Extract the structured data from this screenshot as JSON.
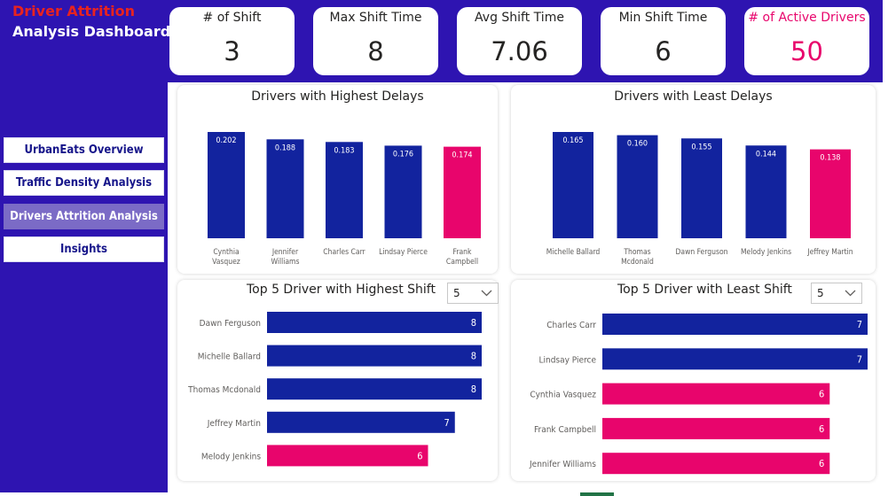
{
  "header": {
    "title_line1": "Driver Attrition",
    "title_line2": "Analysis Dashboard"
  },
  "nav": [
    {
      "label": "UrbanEats Overview",
      "active": false
    },
    {
      "label": "Traffic Density Analysis",
      "active": false
    },
    {
      "label": "Drivers Attrition Analysis",
      "active": true
    },
    {
      "label": "Insights",
      "active": false
    }
  ],
  "kpis": [
    {
      "label": "# of Shift",
      "value": "3",
      "accent": false
    },
    {
      "label": "Max Shift Time",
      "value": "8",
      "accent": false
    },
    {
      "label": "Avg Shift Time",
      "value": "7.06",
      "accent": false
    },
    {
      "label": "Min Shift Time",
      "value": "6",
      "accent": false
    },
    {
      "label": "# of Active Drivers",
      "value": "50",
      "accent": true
    }
  ],
  "colors": {
    "brand": "#2e14b1",
    "bar_primary": "#12239e",
    "bar_highlight": "#e8056c",
    "alert_title": "#e8231f",
    "nav_active": "#7b6bc6"
  },
  "panels": {
    "highest_delays": {
      "title": "Drivers with Highest Delays"
    },
    "least_delays": {
      "title": "Drivers with Least Delays"
    },
    "highest_shift": {
      "title": "Top 5 Driver with Highest Shift",
      "filter_value": "5"
    },
    "least_shift": {
      "title": "Top 5 Driver with Least Shift",
      "filter_value": "5"
    }
  },
  "chart_data": [
    {
      "type": "bar",
      "title": "Drivers with Highest Delays",
      "categories": [
        "Cynthia Vasquez",
        "Jennifer Williams",
        "Charles Carr",
        "Lindsay Pierce",
        "Frank Campbell"
      ],
      "category_lines": [
        [
          "Cynthia",
          "Vasquez"
        ],
        [
          "Jennifer",
          "Williams"
        ],
        [
          "Charles Carr"
        ],
        [
          "Lindsay Pierce"
        ],
        [
          "Frank",
          "Campbell"
        ]
      ],
      "values": [
        0.202,
        0.188,
        0.183,
        0.176,
        0.174
      ],
      "labels": [
        "0.202",
        "0.188",
        "0.183",
        "0.176",
        "0.174"
      ],
      "highlight": [
        false,
        false,
        false,
        false,
        true
      ],
      "ylim": [
        0,
        0.202
      ]
    },
    {
      "type": "bar",
      "title": "Drivers with Least Delays",
      "categories": [
        "Michelle Ballard",
        "Thomas Mcdonald",
        "Dawn Ferguson",
        "Melody Jenkins",
        "Jeffrey Martin"
      ],
      "category_lines": [
        [
          "Michelle Ballard"
        ],
        [
          "Thomas",
          "Mcdonald"
        ],
        [
          "Dawn Ferguson"
        ],
        [
          "Melody Jenkins"
        ],
        [
          "Jeffrey Martin"
        ]
      ],
      "values": [
        0.165,
        0.16,
        0.155,
        0.144,
        0.138
      ],
      "labels": [
        "0.165",
        "0.160",
        "0.155",
        "0.144",
        "0.138"
      ],
      "highlight": [
        false,
        false,
        false,
        false,
        true
      ],
      "ylim": [
        0,
        0.165
      ]
    },
    {
      "type": "bar",
      "orientation": "horizontal",
      "title": "Top 5 Driver with Highest Shift",
      "categories": [
        "Dawn Ferguson",
        "Michelle Ballard",
        "Thomas Mcdonald",
        "Jeffrey Martin",
        "Melody Jenkins"
      ],
      "values": [
        8,
        8,
        8,
        7,
        6
      ],
      "labels": [
        "8",
        "8",
        "8",
        "7",
        "6"
      ],
      "highlight": [
        false,
        false,
        false,
        false,
        true
      ],
      "xlim": [
        0,
        8
      ]
    },
    {
      "type": "bar",
      "orientation": "horizontal",
      "title": "Top 5 Driver with Least Shift",
      "categories": [
        "Charles Carr",
        "Lindsay Pierce",
        "Cynthia Vasquez",
        "Frank Campbell",
        "Jennifer Williams"
      ],
      "values": [
        7,
        7,
        6,
        6,
        6
      ],
      "labels": [
        "7",
        "7",
        "6",
        "6",
        "6"
      ],
      "highlight": [
        false,
        false,
        true,
        true,
        true
      ],
      "xlim": [
        0,
        7
      ]
    }
  ]
}
